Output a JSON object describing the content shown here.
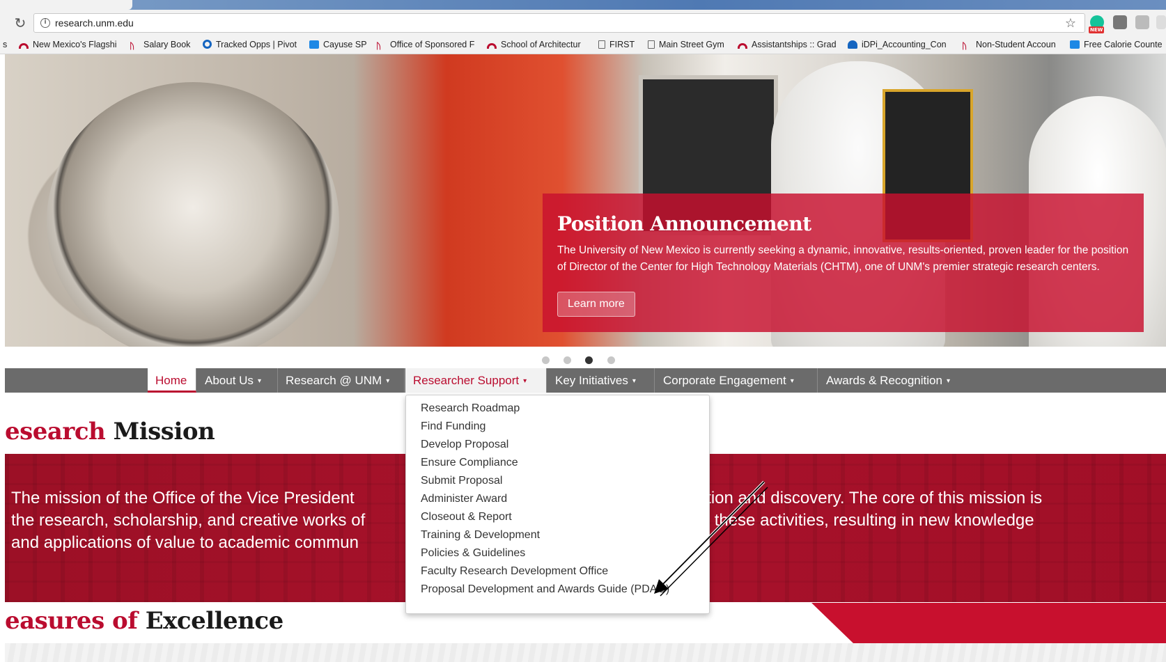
{
  "browser": {
    "url": "research.unm.edu",
    "reload_icon": "reload-icon",
    "info_icon": "info-icon",
    "star_icon": "star-icon",
    "extension_badge": "NEW",
    "bookmarks": [
      {
        "label": "New Mexico's Flagshi",
        "icon": "unm-arc-icon"
      },
      {
        "label": "Salary Book",
        "icon": "unm-logo-icon"
      },
      {
        "label": "Tracked Opps | Pivot",
        "icon": "pivot-icon"
      },
      {
        "label": "Cayuse SP",
        "icon": "cayuse-icon"
      },
      {
        "label": "Office of Sponsored F",
        "icon": "unm-logo-icon"
      },
      {
        "label": "School of Architectur",
        "icon": "unm-arc-icon"
      },
      {
        "label": "FIRST",
        "icon": "page-icon"
      },
      {
        "label": "Main Street Gym",
        "icon": "page-icon"
      },
      {
        "label": "Assistantships :: Grad",
        "icon": "unm-arc-icon"
      },
      {
        "label": "iDPi_Accounting_Con",
        "icon": "cloud-icon"
      },
      {
        "label": "Non-Student Accoun",
        "icon": "unm-logo-icon"
      },
      {
        "label": "Free Calorie Counte",
        "icon": "calorie-icon"
      }
    ]
  },
  "hero": {
    "title": "Position Announcement",
    "body": "The University of New Mexico is currently seeking a dynamic, innovative, results-oriented, proven leader for the position of Director of the Center for High Technology Materials (CHTM), one of UNM's premier strategic research centers.",
    "cta": "Learn more",
    "slides": 4,
    "active_slide": 3
  },
  "nav": {
    "items": [
      {
        "label": "Home",
        "caret": ""
      },
      {
        "label": "About Us",
        "caret": "▾"
      },
      {
        "label": "Research @ UNM",
        "caret": "▾"
      },
      {
        "label": "Researcher Support",
        "caret": "▾"
      },
      {
        "label": "Key Initiatives",
        "caret": "▾"
      },
      {
        "label": "Corporate Engagement",
        "caret": "▾"
      },
      {
        "label": "Awards & Recognition",
        "caret": "▾"
      }
    ],
    "dropdown": [
      "Research Roadmap",
      "Find Funding",
      "Develop Proposal",
      "Ensure Compliance",
      "Submit Proposal",
      "Administer Award",
      "Closeout & Report",
      "Training & Development",
      "Policies & Guidelines",
      "Faculty Research Development Office",
      "Proposal Development and Awards Guide (PDAG)"
    ]
  },
  "mission": {
    "heading_red": "esearch",
    "heading_dark": " Mission",
    "lines": [
      "The mission of the Office of the Vice President                                                                  nnovation and discovery. The core of this mission is",
      "the research, scholarship, and creative works of                                                                cilitate these activities, resulting in new knowledge",
      "and applications of value to academic commun"
    ]
  },
  "measures": {
    "heading_red": "easures of",
    "heading_dark": " Excellence"
  },
  "colors": {
    "unm_red": "#ba0c2f",
    "nav_gray": "#6b6b6b",
    "mission_band": "#a8122b"
  }
}
